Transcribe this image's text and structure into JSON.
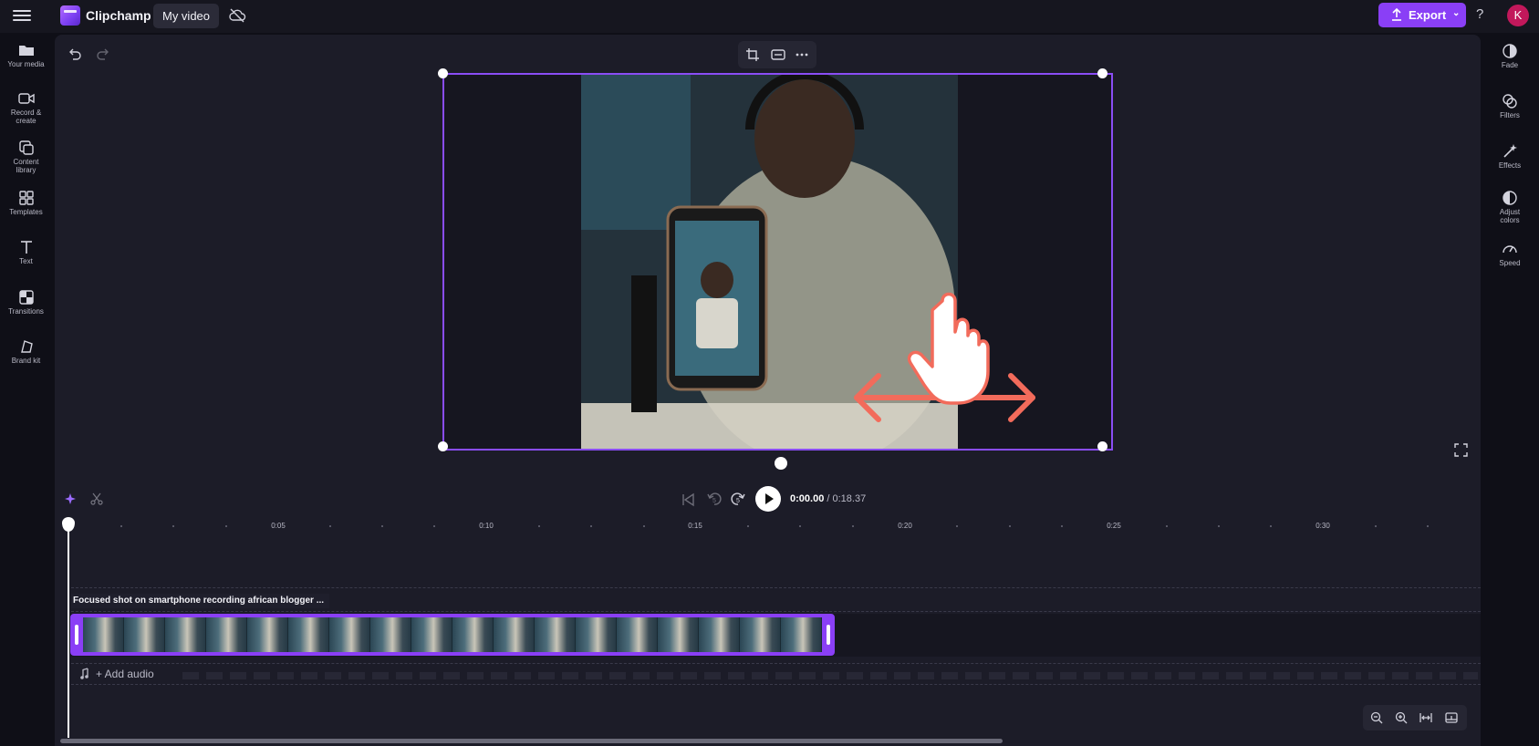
{
  "app": {
    "name": "Clipchamp",
    "project_title": "My video"
  },
  "header": {
    "export_label": "Export",
    "help_label": "?",
    "avatar_initial": "K"
  },
  "left_sidebar": {
    "items": [
      {
        "label": "Your media",
        "icon": "folder-icon"
      },
      {
        "label": "Record & create",
        "icon": "video-camera-icon"
      },
      {
        "label": "Content library",
        "icon": "library-icon"
      },
      {
        "label": "Templates",
        "icon": "templates-icon"
      },
      {
        "label": "Text",
        "icon": "text-icon"
      },
      {
        "label": "Transitions",
        "icon": "transitions-icon"
      },
      {
        "label": "Brand kit",
        "icon": "brand-kit-icon"
      }
    ]
  },
  "right_sidebar": {
    "items": [
      {
        "label": "Fade",
        "icon": "fade-icon"
      },
      {
        "label": "Filters",
        "icon": "filters-icon"
      },
      {
        "label": "Effects",
        "icon": "magic-wand-icon"
      },
      {
        "label": "Adjust colors",
        "icon": "contrast-icon"
      },
      {
        "label": "Speed",
        "icon": "speedometer-icon"
      }
    ]
  },
  "playback": {
    "current_time": "0:00.00",
    "total_time": "/ 0:18.37"
  },
  "ruler": {
    "labels": [
      "0:05",
      "0:10",
      "0:15",
      "0:20",
      "0:25",
      "0:30"
    ]
  },
  "timeline": {
    "clip_title": "Focused shot on smartphone recording african blogger ...",
    "add_audio_label": "+ Add audio"
  },
  "colors": {
    "accent": "#8a3ff6",
    "annotation": "#f26b5b",
    "avatar": "#c2185b"
  }
}
